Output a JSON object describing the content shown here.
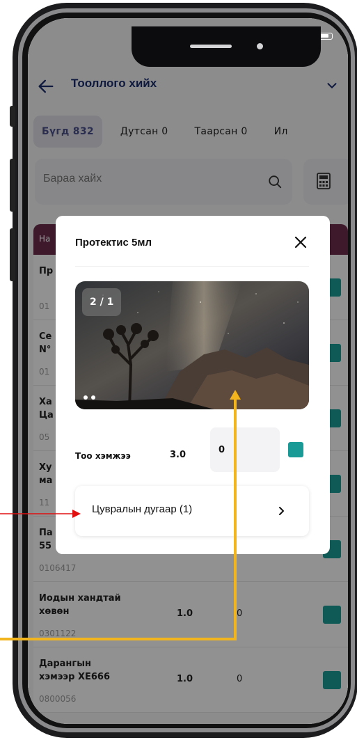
{
  "app": {
    "title": "Тооллого хийх",
    "tabs": [
      {
        "label": "Бүгд 832",
        "active": true
      },
      {
        "label": "Дутсан 0",
        "active": false
      },
      {
        "label": "Таарсан 0",
        "active": false
      },
      {
        "label": "Ил",
        "active": false
      }
    ],
    "search": {
      "placeholder": "Бараа хайх"
    },
    "table_header_label": "На",
    "rows": [
      {
        "name": "Пр",
        "code": "01",
        "qty": "",
        "count": ""
      },
      {
        "name": "Се\nN°",
        "code": "01",
        "qty": "",
        "count": ""
      },
      {
        "name": "Ха\nЦа",
        "code": "05",
        "qty": "",
        "count": ""
      },
      {
        "name": "Ху\nма",
        "code": "11",
        "qty": "",
        "count": ""
      },
      {
        "name": "Па\n55",
        "code": "0106417",
        "qty": "",
        "count": ""
      },
      {
        "name": "Иодын хандтай\nхөвөн",
        "code": "0301122",
        "qty": "1.0",
        "count": "0"
      },
      {
        "name": "Дарангын\nхэмээр XE666",
        "code": "0800056",
        "qty": "1.0",
        "count": "0"
      }
    ]
  },
  "modal": {
    "title": "Протектис 5мл",
    "image_counter": "2 / 1",
    "qty_label": "Тоо хэмжээ",
    "qty_value": "3.0",
    "count_input_value": "0",
    "serial_button_label": "Цувралын дугаар (1)"
  },
  "colors": {
    "accent_teal": "#1a9a96",
    "header_maroon": "#6b2c4b",
    "title_navy": "#1a2e6b",
    "annotation_red": "#e01010",
    "annotation_yellow": "#f2b51d"
  },
  "icons": [
    "back-arrow-icon",
    "chevron-down-icon",
    "search-icon",
    "calculator-icon",
    "close-icon",
    "chevron-right-icon",
    "signal-icon",
    "wifi-icon",
    "battery-icon"
  ]
}
